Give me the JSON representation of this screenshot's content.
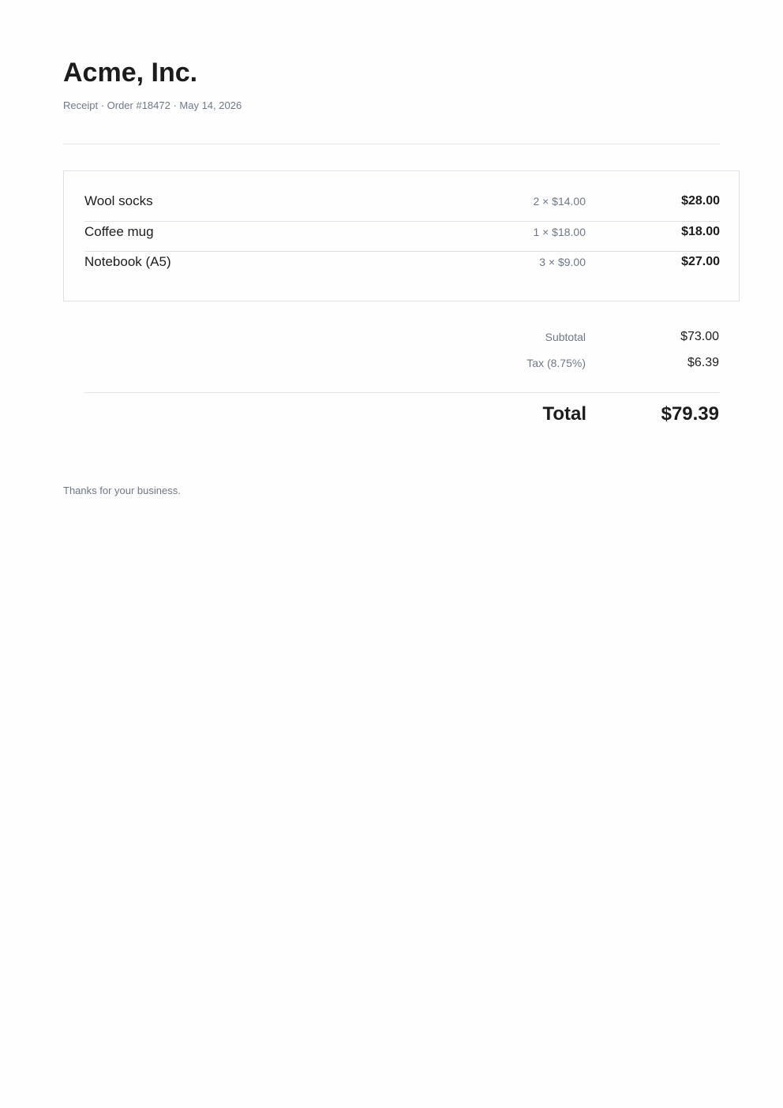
{
  "header": {
    "company": "Acme, Inc.",
    "meta": "Receipt · Order #18472 · May 14, 2026"
  },
  "items": [
    {
      "name": "Wool socks",
      "qty": "2 × $14.00",
      "amount": "$28.00"
    },
    {
      "name": "Coffee mug",
      "qty": "1 × $18.00",
      "amount": "$18.00"
    },
    {
      "name": "Notebook (A5)",
      "qty": "3 × $9.00",
      "amount": "$27.00"
    }
  ],
  "summary": {
    "subtotal_label": "Subtotal",
    "subtotal_value": "$73.00",
    "tax_label": "Tax (8.75%)",
    "tax_value": "$6.39",
    "total_label": "Total",
    "total_value": "$79.39"
  },
  "footer": {
    "note": "Thanks for your business."
  }
}
